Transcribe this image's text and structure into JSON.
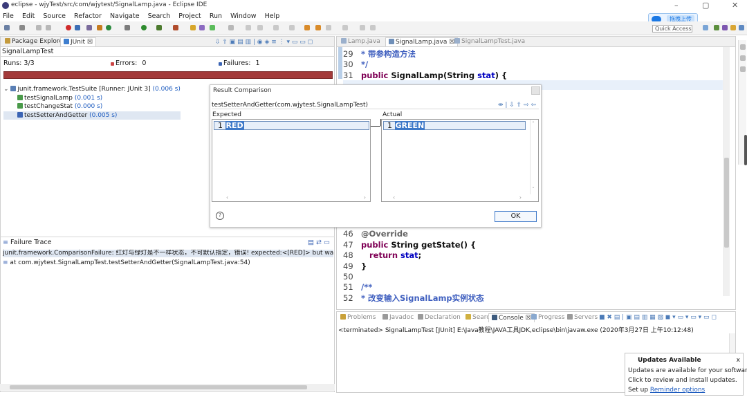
{
  "window": {
    "title": "eclipse - wjyTest/src/com/wjytest/SignalLamp.java - Eclipse IDE",
    "minimize": "–",
    "maximize": "▢",
    "close": "✕"
  },
  "menu": [
    "File",
    "Edit",
    "Source",
    "Refactor",
    "Navigate",
    "Search",
    "Project",
    "Run",
    "Window",
    "Help"
  ],
  "upload_label": "拖拽上传",
  "quick_access": "Quick Access",
  "left_tabs": [
    {
      "label": "Package Explorer"
    },
    {
      "label": "JUnit ☒"
    }
  ],
  "junit": {
    "suite_label": "SignalLampTest",
    "runs_label": "Runs:",
    "runs_value": "3/3",
    "errors_label": "Errors:",
    "errors_value": "0",
    "failures_label": "Failures:",
    "failures_value": "1",
    "tree": {
      "suite": "junit.framework.TestSuite",
      "suite_runner": "[Runner: JUnit 3]",
      "suite_time": "(0.006 s)",
      "tests": [
        {
          "name": "testSignalLamp",
          "time": "(0.001 s)"
        },
        {
          "name": "testChangeStat",
          "time": "(0.000 s)"
        },
        {
          "name": "testSetterAndGetter",
          "time": "(0.005 s)"
        }
      ]
    }
  },
  "failure_trace": {
    "header": "Failure Trace",
    "line1": "junit.framework.ComparisonFailure: 红灯与绿灯是不一样状态，不可默认指定，错误!  expected:<[RED]> but was:<[GR",
    "line2": "at com.wjytest.SignalLampTest.testSetterAndGetter(SignalLampTest.java:54)"
  },
  "editor_tabs": [
    {
      "label": "Lamp.java"
    },
    {
      "label": "SignalLamp.java ☒"
    },
    {
      "label": "SignalLampTest.java"
    }
  ],
  "code_top": [
    {
      "ln": "29",
      "text": "* 带参构造方法"
    },
    {
      "ln": "30",
      "text": "*/"
    },
    {
      "ln": "31",
      "text_kw": "public",
      "text": " SignalLamp(String ",
      "var": "stat",
      "tail": ") {"
    }
  ],
  "code_bottom": [
    {
      "ln": "46",
      "text": "@Override"
    },
    {
      "ln": "47",
      "text_kw": "public",
      "text": " String getState() {"
    },
    {
      "ln": "48",
      "text_kw": "return",
      "var": "stat",
      "tail": ";"
    },
    {
      "ln": "49",
      "text": "}"
    },
    {
      "ln": "50",
      "text": ""
    },
    {
      "ln": "51",
      "text": "/**"
    },
    {
      "ln": "52",
      "text": "* 改变输入SignalLamp实例状态"
    }
  ],
  "dialog": {
    "title": "Result Comparison",
    "test_name": "testSetterAndGetter(com.wjytest.SignalLampTest)",
    "expected_label": "Expected",
    "actual_label": "Actual",
    "expected_line_no": "1",
    "expected_value": "RED",
    "actual_line_no": "1",
    "actual_value": "GREEN",
    "ok": "OK",
    "help": "?"
  },
  "bottom_tabs": [
    {
      "label": "Problems"
    },
    {
      "label": "Javadoc"
    },
    {
      "label": "Declaration"
    },
    {
      "label": "Search"
    },
    {
      "label": "Console ☒"
    },
    {
      "label": "Progress"
    },
    {
      "label": "Servers"
    }
  ],
  "console_text": "<terminated> SignalLampTest [JUnit] E:\\Java教程\\JAVA工具JDK,eclipse\\bin\\javaw.exe (2020年3月27日 上午10:12:48)",
  "notification": {
    "title": "Updates Available",
    "line1": "Updates are available for your software.",
    "line2": "Click to review and install updates.",
    "line3_prefix": "Set up ",
    "line3_link": "Reminder options",
    "close": "x"
  },
  "colors": {
    "failure_bar": "#a33a3a",
    "link": "#1d5bbf",
    "keyword": "#7f0055",
    "diff_highlight": "#3d78c8"
  }
}
